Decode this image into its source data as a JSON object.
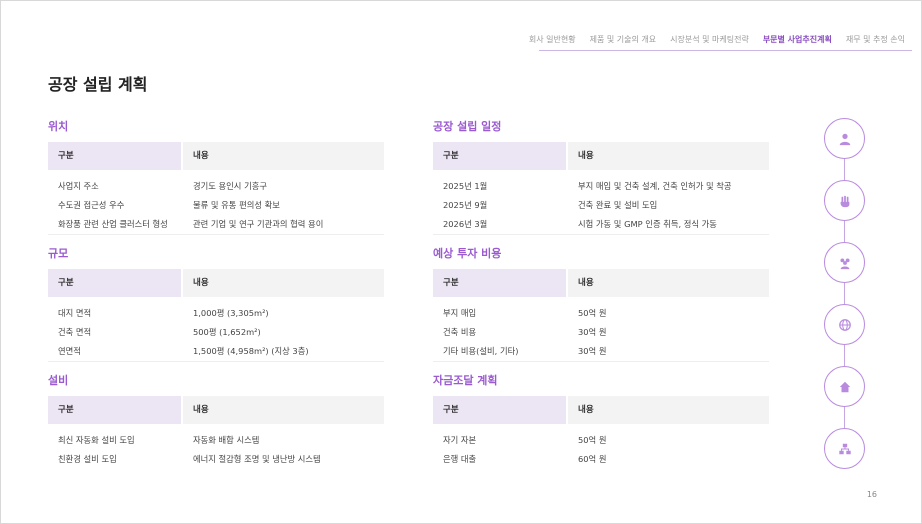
{
  "nav": {
    "items": [
      {
        "label": "회사 일반현황",
        "active": false
      },
      {
        "label": "제품 및 기술의 개요",
        "active": false
      },
      {
        "label": "시장분석 및 마케팅전략",
        "active": false
      },
      {
        "label": "부문별 사업추진계획",
        "active": true
      },
      {
        "label": "재무 및 추정 손익",
        "active": false
      }
    ]
  },
  "page_title": "공장 설립 계획",
  "sections": {
    "location": {
      "title": "위치",
      "header": [
        "구분",
        "내용"
      ],
      "rows": [
        [
          "사업지 주소",
          "경기도 용인시 기흥구"
        ],
        [
          "수도권 접근성 우수",
          "물류 및 유통 편의성 확보"
        ],
        [
          "화장품 관련 산업 클러스터 형성",
          "관련 기업 및 연구 기관과의 협력 용이"
        ]
      ]
    },
    "scale": {
      "title": "규모",
      "header": [
        "구분",
        "내용"
      ],
      "rows": [
        [
          "대지 면적",
          "1,000평 (3,305m²)"
        ],
        [
          "건축 면적",
          "500평 (1,652m²)"
        ],
        [
          "연면적",
          "1,500평 (4,958m²) (지상 3층)"
        ]
      ]
    },
    "equipment": {
      "title": "설비",
      "header": [
        "구분",
        "내용"
      ],
      "rows": [
        [
          "최신 자동화 설비 도입",
          "자동화 배합 시스템"
        ],
        [
          "친환경 설비 도입",
          "에너지 절감형 조명 및 냉난방 시스템"
        ]
      ]
    },
    "schedule": {
      "title": "공장 설립 일정",
      "header": [
        "구분",
        "내용"
      ],
      "rows": [
        [
          "2025년 1월",
          "부지 매입 및 건축 설계, 건축 인허가 및 착공"
        ],
        [
          "2025년 9월",
          "건축 완료 및 설비 도입"
        ],
        [
          "2026년 3월",
          "시험 가동 및 GMP 인증 취득, 정식 가동"
        ]
      ]
    },
    "investment": {
      "title": "예상 투자 비용",
      "header": [
        "구분",
        "내용"
      ],
      "rows": [
        [
          "부지 매입",
          "50억 원"
        ],
        [
          "건축 비용",
          "30억 원"
        ],
        [
          "기타 비용(설비, 기타)",
          "30억 원"
        ]
      ]
    },
    "funding": {
      "title": "자금조달 계획",
      "header": [
        "구분",
        "내용"
      ],
      "rows": [
        [
          "자기 자본",
          "50억 원"
        ],
        [
          "은행 대출",
          "60억 원"
        ]
      ]
    }
  },
  "timeline_icons": [
    "user-badge-icon",
    "hand-icon",
    "people-icon",
    "globe-icon",
    "home-icon",
    "org-chart-icon"
  ],
  "colors": {
    "accent": "#9b5bd0",
    "header_col1": "#ece5f3",
    "header_col2": "#f3f3f3",
    "timeline": "#b98bdf"
  },
  "page_number": "16"
}
